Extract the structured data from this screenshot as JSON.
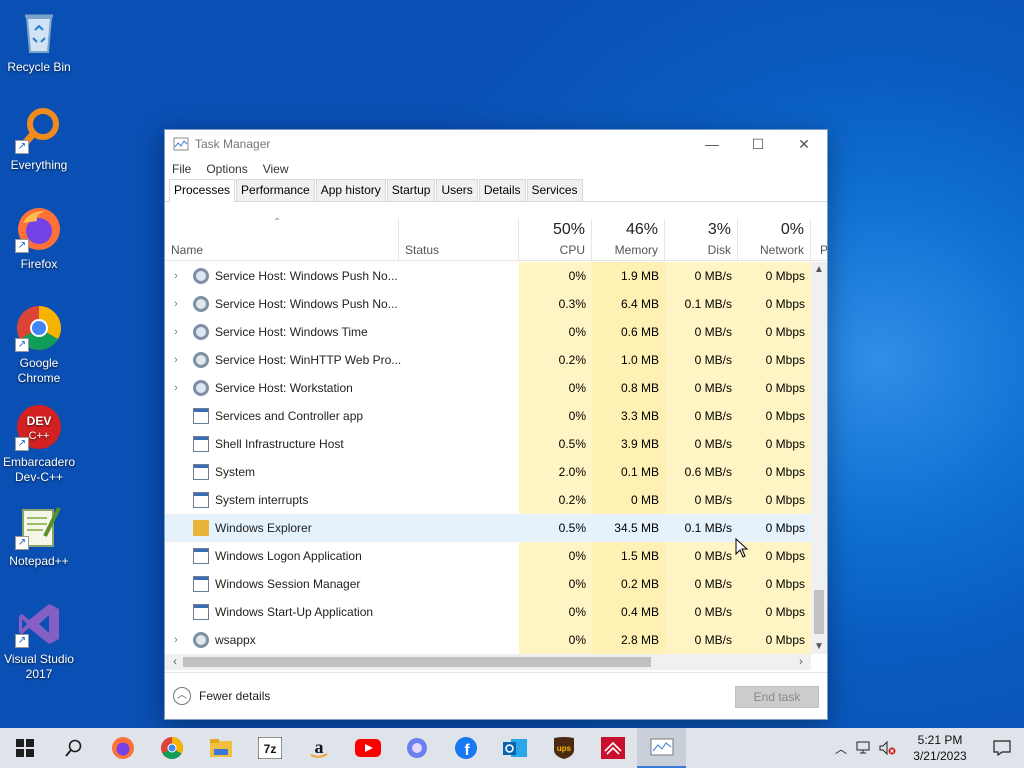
{
  "desktop": {
    "icons": [
      {
        "label": "Recycle Bin",
        "icon": "recycle-bin-icon"
      },
      {
        "label": "Everything",
        "icon": "everything-search-icon"
      },
      {
        "label": "Firefox",
        "icon": "firefox-icon"
      },
      {
        "label": "Google Chrome",
        "icon": "chrome-icon"
      },
      {
        "label": "Embarcadero Dev-C++",
        "icon": "devcpp-icon"
      },
      {
        "label": "Notepad++",
        "icon": "notepadpp-icon"
      },
      {
        "label": "Visual Studio 2017",
        "icon": "visual-studio-icon"
      }
    ]
  },
  "window": {
    "title": "Task Manager",
    "menu": [
      "File",
      "Options",
      "View"
    ],
    "tabs": [
      "Processes",
      "Performance",
      "App history",
      "Startup",
      "Users",
      "Details",
      "Services"
    ],
    "active_tab": "Processes",
    "columns": {
      "name": "Name",
      "status": "Status",
      "cpu": {
        "pct": "50%",
        "label": "CPU"
      },
      "memory": {
        "pct": "46%",
        "label": "Memory"
      },
      "disk": {
        "pct": "3%",
        "label": "Disk"
      },
      "network": {
        "pct": "0%",
        "label": "Network"
      },
      "power_partial": "P"
    },
    "rows": [
      {
        "name": "Service Host: Windows Push No...",
        "expand": true,
        "icon": "gear",
        "cpu": "0%",
        "memory": "1.9 MB",
        "disk": "0 MB/s",
        "network": "0 Mbps"
      },
      {
        "name": "Service Host: Windows Push No...",
        "expand": true,
        "icon": "gear",
        "cpu": "0.3%",
        "memory": "6.4 MB",
        "disk": "0.1 MB/s",
        "network": "0 Mbps"
      },
      {
        "name": "Service Host: Windows Time",
        "expand": true,
        "icon": "gear",
        "cpu": "0%",
        "memory": "0.6 MB",
        "disk": "0 MB/s",
        "network": "0 Mbps"
      },
      {
        "name": "Service Host: WinHTTP Web Pro...",
        "expand": true,
        "icon": "gear",
        "cpu": "0.2%",
        "memory": "1.0 MB",
        "disk": "0 MB/s",
        "network": "0 Mbps"
      },
      {
        "name": "Service Host: Workstation",
        "expand": true,
        "icon": "gear",
        "cpu": "0%",
        "memory": "0.8 MB",
        "disk": "0 MB/s",
        "network": "0 Mbps"
      },
      {
        "name": "Services and Controller app",
        "expand": false,
        "icon": "app",
        "cpu": "0%",
        "memory": "3.3 MB",
        "disk": "0 MB/s",
        "network": "0 Mbps"
      },
      {
        "name": "Shell Infrastructure Host",
        "expand": false,
        "icon": "app",
        "cpu": "0.5%",
        "memory": "3.9 MB",
        "disk": "0 MB/s",
        "network": "0 Mbps"
      },
      {
        "name": "System",
        "expand": false,
        "icon": "app",
        "cpu": "2.0%",
        "memory": "0.1 MB",
        "disk": "0.6 MB/s",
        "network": "0 Mbps"
      },
      {
        "name": "System interrupts",
        "expand": false,
        "icon": "app",
        "cpu": "0.2%",
        "memory": "0 MB",
        "disk": "0 MB/s",
        "network": "0 Mbps"
      },
      {
        "name": "Windows Explorer",
        "expand": false,
        "icon": "folder",
        "cpu": "0.5%",
        "memory": "34.5 MB",
        "disk": "0.1 MB/s",
        "network": "0 Mbps",
        "selected": true
      },
      {
        "name": "Windows Logon Application",
        "expand": false,
        "icon": "app",
        "cpu": "0%",
        "memory": "1.5 MB",
        "disk": "0 MB/s",
        "network": "0 Mbps"
      },
      {
        "name": "Windows Session Manager",
        "expand": false,
        "icon": "app",
        "cpu": "0%",
        "memory": "0.2 MB",
        "disk": "0 MB/s",
        "network": "0 Mbps"
      },
      {
        "name": "Windows Start-Up Application",
        "expand": false,
        "icon": "app",
        "cpu": "0%",
        "memory": "0.4 MB",
        "disk": "0 MB/s",
        "network": "0 Mbps"
      },
      {
        "name": "wsappx",
        "expand": true,
        "icon": "gear",
        "cpu": "0%",
        "memory": "2.8 MB",
        "disk": "0 MB/s",
        "network": "0 Mbps"
      }
    ],
    "footer": {
      "fewer_details": "Fewer details",
      "end_task": "End task"
    }
  },
  "taskbar": {
    "items": [
      "start-icon",
      "search-icon",
      "firefox-icon",
      "chrome-icon",
      "file-explorer-icon",
      "7zip-icon",
      "amazon-icon",
      "youtube-icon",
      "copilot-icon",
      "facebook-icon",
      "outlook-icon",
      "ups-icon",
      "bank-icon",
      "task-manager-icon"
    ],
    "labels": {
      "7zip": "7z",
      "ups": "ups"
    },
    "active": "task-manager-icon",
    "time": "5:21 PM",
    "date": "3/21/2023"
  },
  "colors": {
    "accent": "#3b78d8",
    "cpu_fill": "#fff4c4",
    "mem_fill": "#fff0b4",
    "selected_row": "#e5f1fb"
  }
}
